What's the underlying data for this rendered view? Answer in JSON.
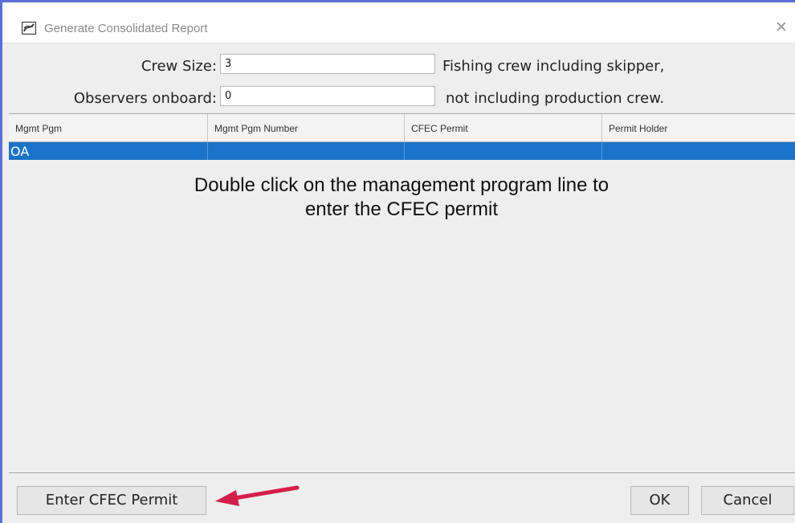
{
  "window": {
    "title": "Generate Consolidated Report",
    "icon": "app-logo-icon",
    "close_glyph": "✕"
  },
  "form": {
    "crew_size": {
      "label": "Crew Size:",
      "value": "3",
      "hint": "Fishing crew including skipper,"
    },
    "observers": {
      "label": "Observers onboard:",
      "value": "0",
      "hint": "not including production crew."
    }
  },
  "table": {
    "columns": [
      "Mgmt Pgm",
      "Mgmt Pgm Number",
      "CFEC Permit",
      "Permit Holder"
    ],
    "rows": [
      {
        "mgmt_pgm": "OA",
        "mgmt_pgm_number": "",
        "cfec_permit": "",
        "permit_holder": ""
      }
    ],
    "selected_row_color": "#1a73c8"
  },
  "annotation": {
    "line1": "Double click on the management program line to",
    "line2": "enter the CFEC permit",
    "arrow_color": "#d21f4a"
  },
  "buttons": {
    "enter_cfec": "Enter CFEC Permit",
    "ok": "OK",
    "cancel": "Cancel"
  }
}
